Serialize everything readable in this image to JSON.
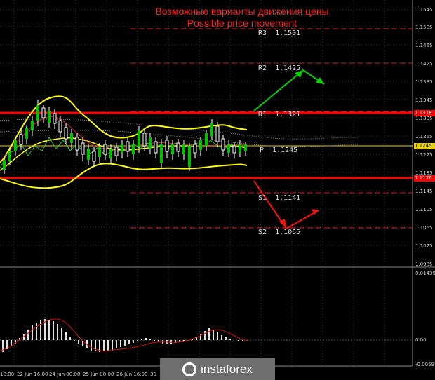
{
  "title": {
    "line1": "Возможные варианты движения цены",
    "line2": "Possible price movement"
  },
  "levels": {
    "r3": "R3  1.1501",
    "r2": "R2  1.1425",
    "r1": "R1  1.1321",
    "p": "P  1.1245",
    "s1": "S1  1.1141",
    "s2": "S2  1.1065"
  },
  "price_tags": {
    "upper": "1.1318",
    "current": "1.1245",
    "lower": "1.1176"
  },
  "price_axis": [
    "1.1545",
    "1.1505",
    "1.1465",
    "1.1425",
    "1.1385",
    "1.1345",
    "1.1305",
    "1.1265",
    "1.1225",
    "1.1185",
    "1.1145",
    "1.1105",
    "1.1065",
    "1.1025",
    "1.0985"
  ],
  "osc_axis": {
    "top": "0.01439",
    "mid": "0.00",
    "bottom": "-0.00595"
  },
  "time_axis": [
    "18:00",
    "22 Jun 16:00",
    "24 Jun 00:00",
    "25 Jun 08:00",
    "26 Jun 16:00",
    "30"
  ],
  "colors": {
    "bg": "#000000",
    "resistance": "#ff0000",
    "pivot": "#e8d000",
    "arrow_up": "#00d000",
    "arrow_down": "#ff1010",
    "bands": "#ffff00"
  },
  "watermark": {
    "text": "instaforex",
    "icon": "instaforex-logo-icon"
  }
}
